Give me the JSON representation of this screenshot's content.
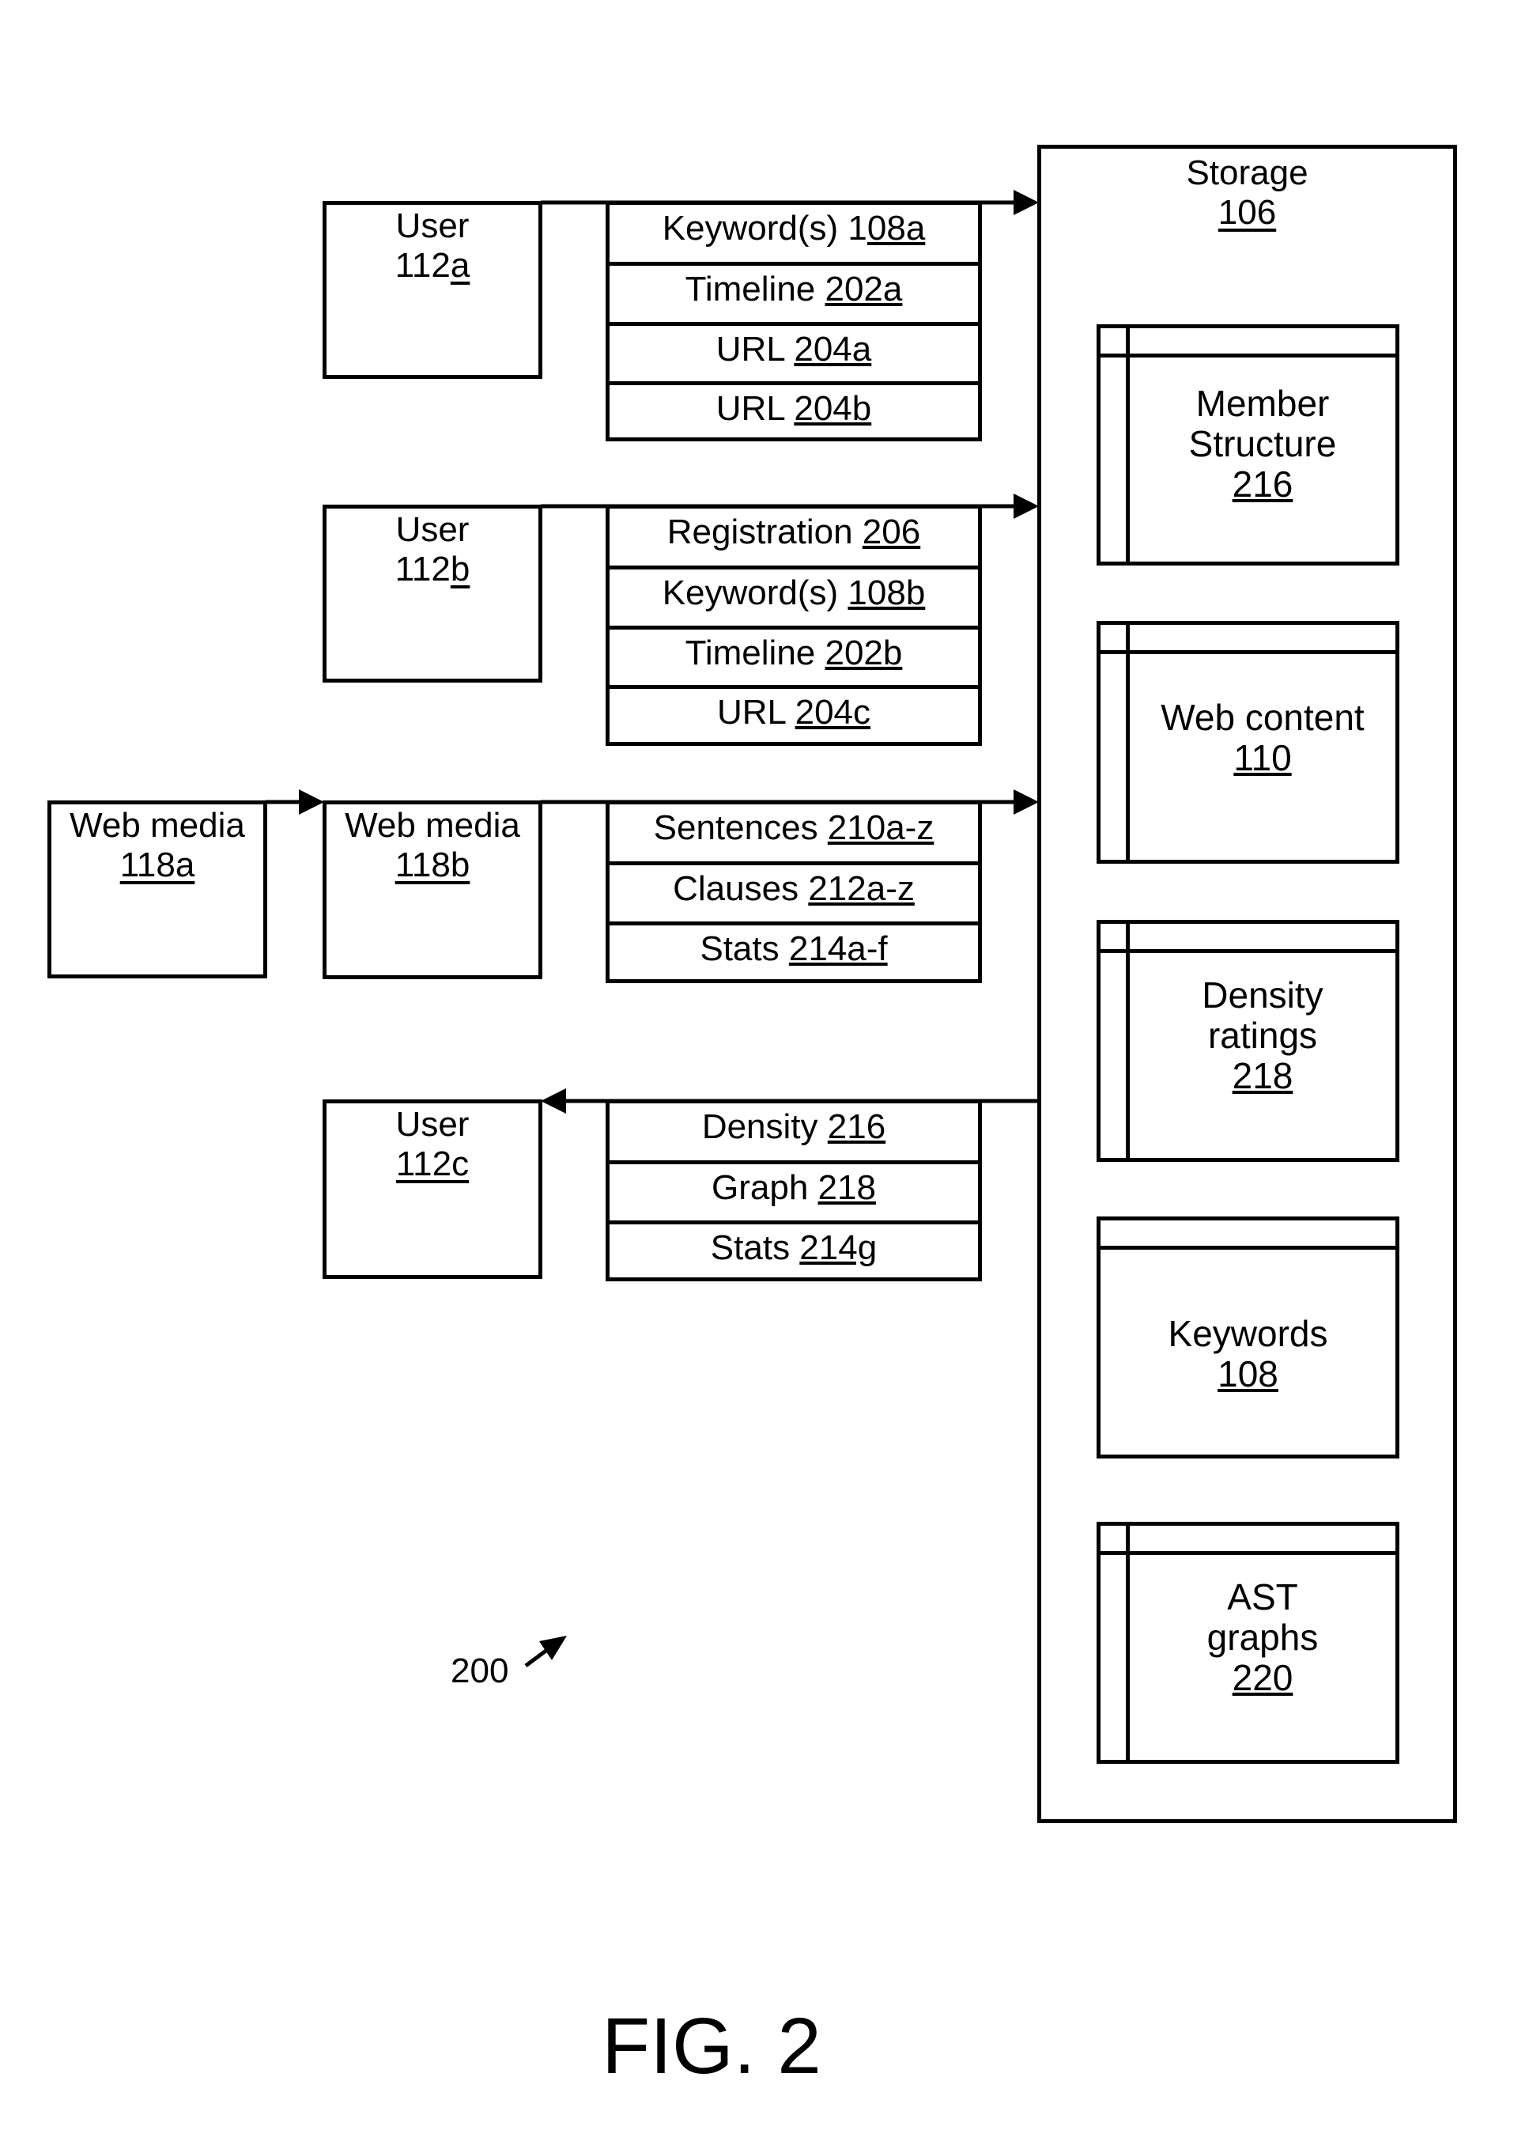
{
  "storage": {
    "title": "Storage",
    "ref": "106",
    "items": [
      {
        "lines": [
          "Member",
          "Structure"
        ],
        "ref": "216",
        "sidebar": true
      },
      {
        "lines": [
          "Web content"
        ],
        "ref": "110",
        "sidebar": true
      },
      {
        "lines": [
          "Density",
          "ratings"
        ],
        "ref": "218",
        "sidebar": true
      },
      {
        "lines": [
          "Keywords"
        ],
        "ref": "108",
        "sidebar": false
      },
      {
        "lines": [
          "AST",
          "graphs"
        ],
        "ref": "220",
        "sidebar": true
      }
    ]
  },
  "sources": [
    {
      "name": "User",
      "ref_prefix": "112",
      "ref_suffix": "a",
      "rows": [
        {
          "label": "Keyword(s) 1",
          "ref": "08a"
        },
        {
          "label": "Timeline ",
          "ref": "202a"
        },
        {
          "label": "URL ",
          "ref": "204a"
        },
        {
          "label": "URL ",
          "ref": "204b"
        }
      ]
    },
    {
      "name": "User",
      "ref_prefix": "112",
      "ref_suffix": "b",
      "rows": [
        {
          "label": "Registration ",
          "ref": "206"
        },
        {
          "label": "Keyword(s) ",
          "ref": "108b"
        },
        {
          "label": "Timeline ",
          "ref": "202b"
        },
        {
          "label": "URL ",
          "ref": "204c"
        }
      ]
    },
    {
      "name": "Web media",
      "ref": "118b",
      "upstream": {
        "name": "Web media",
        "ref": "118a"
      },
      "rows": [
        {
          "label": "Sentences ",
          "ref": "210a-z"
        },
        {
          "label": "Clauses ",
          "ref": "212a-z"
        },
        {
          "label": "Stats ",
          "ref": "214a-f"
        }
      ]
    },
    {
      "name": "User",
      "ref": "112c",
      "direction": "from-storage",
      "rows": [
        {
          "label": "Density ",
          "ref": "216"
        },
        {
          "label": "Graph ",
          "ref": "218"
        },
        {
          "label": "Stats ",
          "ref": "214g"
        }
      ]
    }
  ],
  "figure_ref": "200",
  "figure_label": "FIG. 2",
  "colors": {
    "stroke": "#000000",
    "background": "#ffffff"
  }
}
